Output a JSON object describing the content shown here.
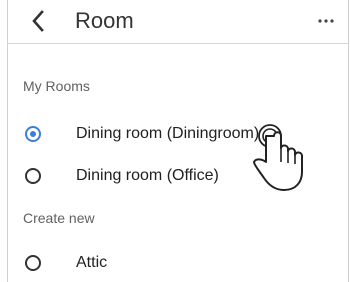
{
  "header": {
    "back_icon": "chevron-left-icon",
    "title": "Room",
    "more_icon": "more-horizontal-icon"
  },
  "my_rooms": {
    "heading": "My Rooms",
    "items": [
      {
        "label": "Dining room (Diningroom)",
        "selected": true
      },
      {
        "label": "Dining room (Office)",
        "selected": false
      }
    ]
  },
  "create_new": {
    "heading": "Create new",
    "items": [
      {
        "label": "Attic",
        "selected": false
      }
    ]
  },
  "colors": {
    "accent": "#3d7fd8",
    "divider": "#d6d6d6",
    "text_primary": "#212121",
    "text_secondary": "#616161"
  },
  "overlay": {
    "icon": "tap-hand-icon"
  }
}
